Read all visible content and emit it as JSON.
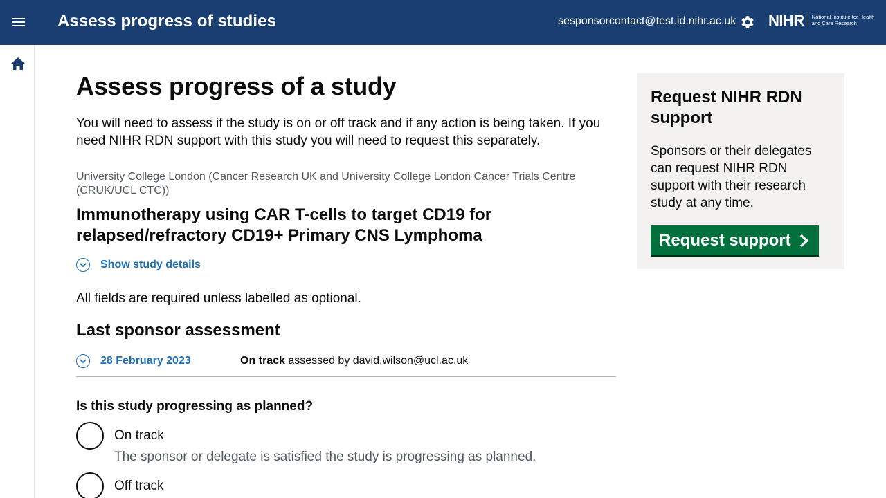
{
  "header": {
    "title": "Assess progress of studies",
    "user_email": "sesponsorcontact@test.id.nihr.ac.uk",
    "logo_text": "NIHR",
    "logo_subtext": "National Institute for Health and Care Research"
  },
  "page": {
    "title": "Assess progress of a study",
    "intro": "You will need to assess if the study is on or off track and if any action is being taken. If you need NIHR RDN support with this study you will need to request this separately.",
    "sponsor_org": "University College London (Cancer Research UK and University College London Cancer Trials Centre (CRUK/UCL CTC))",
    "study_title": "Immunotherapy using CAR T-cells to target CD19 for relapsed/refractory CD19+ Primary CNS Lymphoma",
    "details_toggle": "Show study details",
    "fields_hint": "All fields are required unless labelled as optional.",
    "last_assessment_heading": "Last sponsor assessment",
    "last_assessment": {
      "date": "28 February 2023",
      "status": "On track",
      "assessed_by_text": "assessed by david.wilson@ucl.ac.uk"
    },
    "question": "Is this study progressing as planned?",
    "options": [
      {
        "label": "On track",
        "hint": "The sponsor or delegate is satisfied the study is progressing as planned."
      },
      {
        "label": "Off track"
      }
    ]
  },
  "aside": {
    "title": "Request NIHR RDN support",
    "text": "Sponsors or their delegates can request NIHR RDN support with their research study at any time.",
    "button_label": "Request support"
  },
  "colors": {
    "header_bg": "#193e72",
    "link": "#1d70b8",
    "button_bg": "#00703c",
    "panel_bg": "#f3f2f1"
  }
}
